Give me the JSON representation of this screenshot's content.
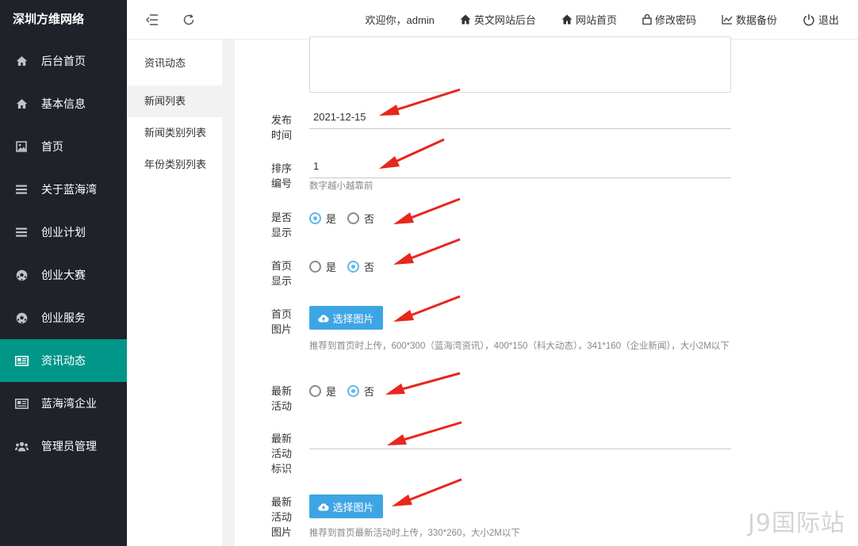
{
  "brand": "深圳方维网络",
  "sidebar": {
    "items": [
      {
        "label": "后台首页",
        "icon": "home-icon",
        "active": false
      },
      {
        "label": "基本信息",
        "icon": "home-icon",
        "active": false
      },
      {
        "label": "首页",
        "icon": "image-icon",
        "active": false
      },
      {
        "label": "关于蓝海湾",
        "icon": "list-icon",
        "active": false
      },
      {
        "label": "创业计划",
        "icon": "list-icon",
        "active": false
      },
      {
        "label": "创业大赛",
        "icon": "football-icon",
        "active": false
      },
      {
        "label": "创业服务",
        "icon": "football-icon",
        "active": false
      },
      {
        "label": "资讯动态",
        "icon": "newspaper-icon",
        "active": true
      },
      {
        "label": "蓝海湾企业",
        "icon": "newspaper-icon",
        "active": false
      },
      {
        "label": "管理员管理",
        "icon": "users-icon",
        "active": false
      }
    ]
  },
  "header": {
    "welcome": "欢迎你，admin",
    "links": [
      {
        "label": "英文网站后台",
        "icon": "home-icon"
      },
      {
        "label": "网站首页",
        "icon": "home-icon"
      },
      {
        "label": "修改密码",
        "icon": "lock-icon"
      },
      {
        "label": "数据备份",
        "icon": "chart-icon"
      },
      {
        "label": "退出",
        "icon": "power-icon"
      }
    ]
  },
  "submenu": {
    "title": "资讯动态",
    "items": [
      {
        "label": "新闻列表",
        "active": true
      },
      {
        "label": "新闻类别列表",
        "active": false
      },
      {
        "label": "年份类别列表",
        "active": false
      }
    ]
  },
  "form": {
    "publish_time": {
      "label": "发布时间",
      "value": "2021-12-15"
    },
    "sort_number": {
      "label": "排序编号",
      "value": "1",
      "hint": "数字越小越靠前"
    },
    "is_display": {
      "label": "是否显示",
      "options": [
        "是",
        "否"
      ],
      "selected": "是"
    },
    "home_display": {
      "label": "首页显示",
      "options": [
        "是",
        "否"
      ],
      "selected": "否"
    },
    "home_image": {
      "label": "首页图片",
      "button": "选择图片",
      "hint": "推荐到首页时上传，600*300（蓝海湾资讯），400*150（科大动态），341*160（企业新闻），大小2M以下"
    },
    "latest_activity": {
      "label": "最新活动",
      "options": [
        "是",
        "否"
      ],
      "selected": "否"
    },
    "activity_tag": {
      "label": "最新活动标识",
      "value": ""
    },
    "activity_image": {
      "label": "最新活动图片",
      "button": "选择图片",
      "hint": "推荐到首页最新活动时上传，330*260，大小2M以下"
    }
  },
  "colors": {
    "sidebar_bg": "#20222a",
    "active_teal": "#009688",
    "button_blue": "#3ea5e5",
    "radio_blue": "#5fb8e9",
    "annotation_arrow": "#e8261c"
  },
  "watermark": "J9国际站"
}
